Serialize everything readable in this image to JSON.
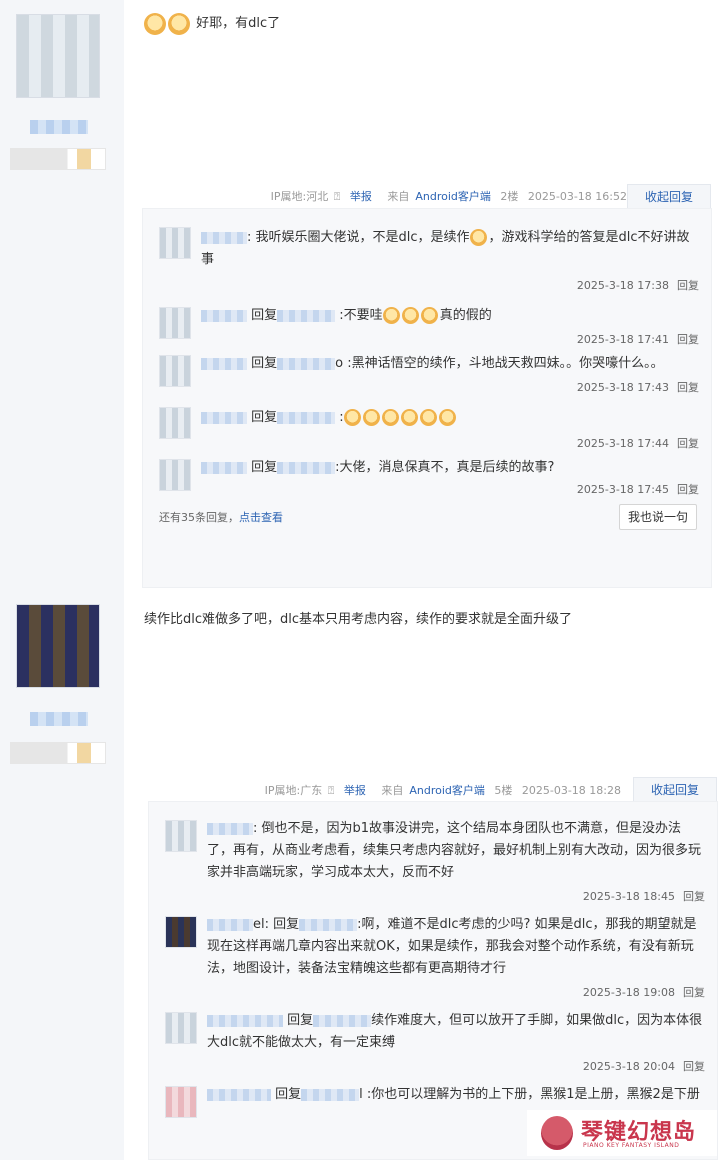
{
  "post1": {
    "text": "好耶，有dlc了",
    "meta": {
      "ip": "IP属地:河北",
      "help_icon": "question-circle-icon",
      "report": "举报",
      "source_prefix": "来自",
      "source_link": "Android客户端",
      "floor": "2楼",
      "time": "2025-03-18 16:52",
      "collapse": "收起回复"
    },
    "replies": [
      {
        "text_a": ": 我听娱乐圈大佬说，不是dlc，是续作",
        "text_b": "，游戏科学给的答复是dlc不好讲故事",
        "time": "2025-3-18 17:38",
        "reply": "回复"
      },
      {
        "prefix": "回复",
        "text": ":不要哇",
        "text_b": "真的假的",
        "time": "2025-3-18 17:41",
        "reply": "回复"
      },
      {
        "prefix": "回复",
        "text": "o :黑神话悟空的续作，斗地战天救四妹。。你哭嚎什么。。",
        "time": "2025-3-18 17:43",
        "reply": "回复"
      },
      {
        "prefix": "回复",
        "text": ":",
        "time": "2025-3-18 17:44",
        "reply": "回复"
      },
      {
        "prefix": "回复",
        "text": ":大佬，消息保真不，真是后续的故事?",
        "time": "2025-3-18 17:45",
        "reply": "回复"
      }
    ],
    "more_prefix": "还有35条回复，",
    "more_link": "点击查看",
    "say_button": "我也说一句"
  },
  "post2": {
    "text": "续作比dlc难做多了吧，dlc基本只用考虑内容，续作的要求就是全面升级了",
    "meta": {
      "ip": "IP属地:广东",
      "help_icon": "question-circle-icon",
      "report": "举报",
      "source_prefix": "来自",
      "source_link": "Android客户端",
      "floor": "5楼",
      "time": "2025-03-18 18:28",
      "collapse": "收起回复"
    },
    "replies": [
      {
        "text": ": 倒也不是，因为b1故事没讲完，这个结局本身团队也不满意，但是没办法了，再有，从商业考虑看，续集只考虑内容就好，最好机制上别有大改动，因为很多玩家并非高端玩家，学习成本太大，反而不好",
        "time": "2025-3-18 18:45",
        "reply": "回复"
      },
      {
        "prefix": "el: 回复",
        "text": ":啊，难道不是dlc考虑的少吗? 如果是dlc，那我的期望就是现在这样再端几章内容出来就OK，如果是续作，那我会对整个动作系统，有没有新玩法，地图设计，装备法宝精魄这些都有更高期待才行",
        "time": "2025-3-18 19:08",
        "reply": "回复"
      },
      {
        "prefix": "回复",
        "text": "续作难度大，但可以放开了手脚，如果做dlc，因为本体很大dlc就不能做太大，有一定束缚",
        "time": "2025-3-18 20:04",
        "reply": "回复"
      },
      {
        "prefix": "回复",
        "text": "l :你也可以理解为书的上下册，黑猴1是上册，黑猴2是下册"
      }
    ]
  },
  "watermark": {
    "title": "琴键幻想岛",
    "subtitle": "PIANO KEY FANTASY ISLAND"
  },
  "colors": {
    "link": "#2d64b3",
    "watermark": "#c9364d",
    "left_bg": "#f4f6f9"
  }
}
